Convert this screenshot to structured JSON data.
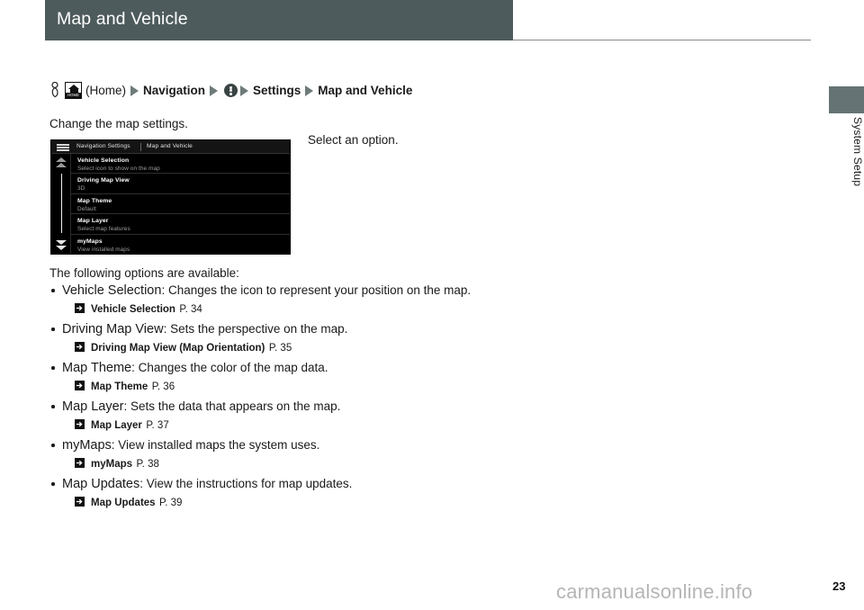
{
  "header": {
    "title": "Map and Vehicle"
  },
  "side_tab": {
    "label": "System Setup"
  },
  "breadcrumb": {
    "touch_icon": "touch-finger-icon",
    "home_icon": "home-button-icon",
    "home_icon_word": "HOME",
    "home_label": "(Home)",
    "arrow_icon": "triangle-right-icon",
    "nav_label": "Navigation",
    "menu_icon": "vertical-ellipsis-menu-icon",
    "settings_label": "Settings",
    "target_label": "Map and Vehicle"
  },
  "intro": {
    "text": "Change the map settings.",
    "caption_right": "Select an option."
  },
  "nav_screenshot": {
    "hamburger_icon": "hamburger-menu-icon",
    "title_left": "Navigation Settings",
    "title_right": "Map and Vehicle",
    "scroll_up_icon": "double-chevron-up-icon",
    "scroll_down_icon": "double-chevron-down-icon",
    "items": [
      {
        "title": "Vehicle Selection",
        "subtitle": "Select icon to show on the map"
      },
      {
        "title": "Driving Map View",
        "subtitle": "3D"
      },
      {
        "title": "Map Theme",
        "subtitle": "Default"
      },
      {
        "title": "Map Layer",
        "subtitle": "Select map features"
      },
      {
        "title": "myMaps",
        "subtitle": "View installed maps"
      }
    ]
  },
  "options": {
    "intro": "The following options are available:",
    "items": [
      {
        "name": "Vehicle Selection",
        "desc": ": Changes the icon to represent your position on the map.",
        "ref_title": "Vehicle Selection",
        "ref_page": "P. 34"
      },
      {
        "name": "Driving Map View",
        "desc": ": Sets the perspective on the map.",
        "ref_title": "Driving Map View (Map Orientation)",
        "ref_page": "P. 35"
      },
      {
        "name": "Map Theme",
        "desc": ": Changes the color of the map data.",
        "ref_title": "Map Theme",
        "ref_page": "P. 36"
      },
      {
        "name": "Map Layer",
        "desc": ": Sets the data that appears on the map.",
        "ref_title": "Map Layer",
        "ref_page": "P. 37"
      },
      {
        "name": "myMaps",
        "desc": ": View installed maps the system uses.",
        "ref_title": "myMaps",
        "ref_page": "P. 38"
      },
      {
        "name": "Map Updates",
        "desc": ": View the instructions for map updates.",
        "ref_title": "Map Updates",
        "ref_page": "P. 39"
      }
    ]
  },
  "footer": {
    "watermark": "carmanualsonline.info",
    "page_number": "23"
  },
  "colors": {
    "header_bg": "#4e5b5c",
    "side_tab_bg": "#667374",
    "breadcrumb_arrow": "#6e7a7a",
    "screen_bg": "#000000",
    "watermark": "#b5b5b5"
  }
}
